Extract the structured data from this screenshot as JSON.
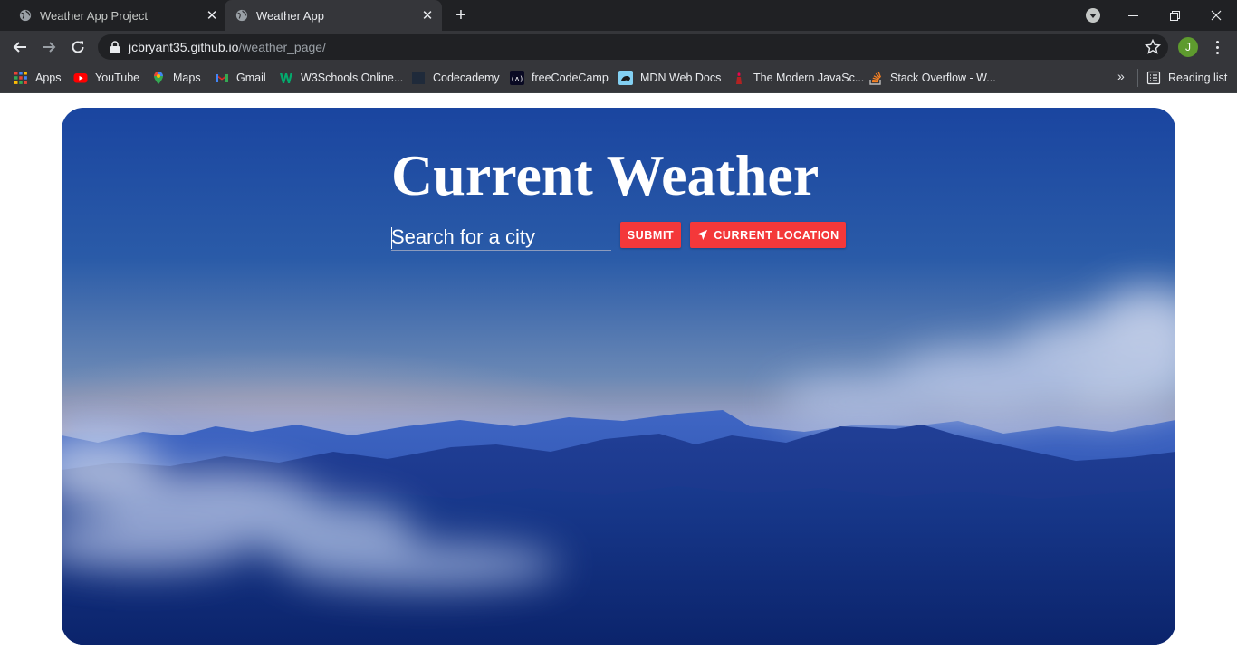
{
  "browser": {
    "tabs": [
      {
        "title": "Weather App Project",
        "icon": "globe-icon",
        "active": false
      },
      {
        "title": "Weather App",
        "icon": "globe-icon",
        "active": true
      }
    ],
    "new_tab_label": "+",
    "url_host": "jcbryant35.github.io",
    "url_path": "/weather_page/",
    "profile_initial": "J",
    "bookmarks": [
      {
        "label": "Apps",
        "icon": "apps-grid-icon"
      },
      {
        "label": "YouTube",
        "icon": "youtube-icon"
      },
      {
        "label": "Maps",
        "icon": "maps-pin-icon"
      },
      {
        "label": "Gmail",
        "icon": "gmail-icon"
      },
      {
        "label": "W3Schools Online...",
        "icon": "w3schools-icon"
      },
      {
        "label": "Codecademy",
        "icon": "codecademy-icon"
      },
      {
        "label": "freeCodeCamp",
        "icon": "freecodecamp-icon"
      },
      {
        "label": "MDN Web Docs",
        "icon": "mdn-icon"
      },
      {
        "label": "The Modern JavaSc...",
        "icon": "javascript-info-icon"
      },
      {
        "label": "Stack Overflow - W...",
        "icon": "stackoverflow-icon"
      }
    ],
    "more_bookmarks": "»",
    "reading_list": "Reading list"
  },
  "page": {
    "title": "Current Weather",
    "search_placeholder": "Search for a city",
    "submit_label": "SUBMIT",
    "location_label": "CURRENT LOCATION",
    "colors": {
      "button": "#f4383a",
      "sky_top": "#1a45a0",
      "sky_bottom": "#0d2a78"
    }
  }
}
